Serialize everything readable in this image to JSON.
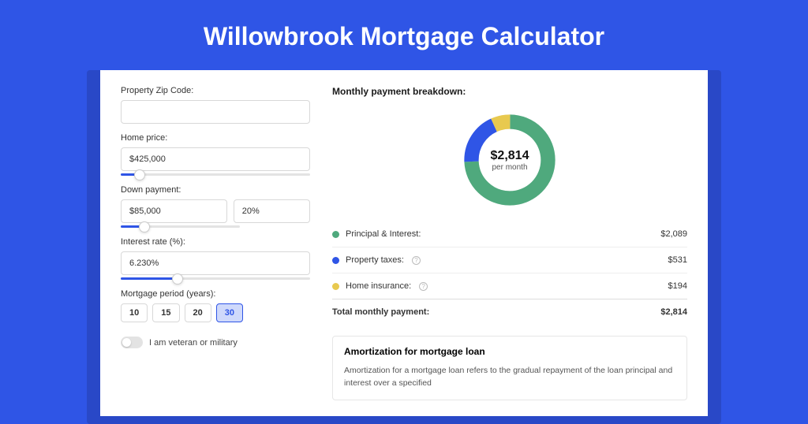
{
  "title": "Willowbrook Mortgage Calculator",
  "form": {
    "zip_label": "Property Zip Code:",
    "zip_value": "",
    "home_price_label": "Home price:",
    "home_price_value": "$425,000",
    "home_price_slider_pct": 10,
    "down_label": "Down payment:",
    "down_amount_value": "$85,000",
    "down_pct_value": "20%",
    "down_slider_pct": 20,
    "rate_label": "Interest rate (%):",
    "rate_value": "6.230%",
    "rate_slider_pct": 30,
    "period_label": "Mortgage period (years):",
    "period_options": [
      "10",
      "15",
      "20",
      "30"
    ],
    "period_active_index": 3,
    "veteran_label": "I am veteran or military",
    "veteran_on": false
  },
  "breakdown": {
    "title": "Monthly payment breakdown:",
    "center_amount": "$2,814",
    "center_sub": "per month",
    "rows": [
      {
        "label": "Principal & Interest:",
        "value": "$2,089",
        "color": "#4fa97d",
        "info": false
      },
      {
        "label": "Property taxes:",
        "value": "$531",
        "color": "#2f55e6",
        "info": true
      },
      {
        "label": "Home insurance:",
        "value": "$194",
        "color": "#e8c94f",
        "info": true
      }
    ],
    "total_label": "Total monthly payment:",
    "total_value": "$2,814"
  },
  "chart_data": {
    "type": "pie",
    "title": "Monthly payment breakdown",
    "series": [
      {
        "name": "Principal & Interest",
        "value": 2089,
        "color": "#4fa97d"
      },
      {
        "name": "Property taxes",
        "value": 531,
        "color": "#2f55e6"
      },
      {
        "name": "Home insurance",
        "value": 194,
        "color": "#e8c94f"
      }
    ],
    "total": 2814,
    "unit": "USD/month"
  },
  "amort": {
    "title": "Amortization for mortgage loan",
    "text": "Amortization for a mortgage loan refers to the gradual repayment of the loan principal and interest over a specified"
  }
}
